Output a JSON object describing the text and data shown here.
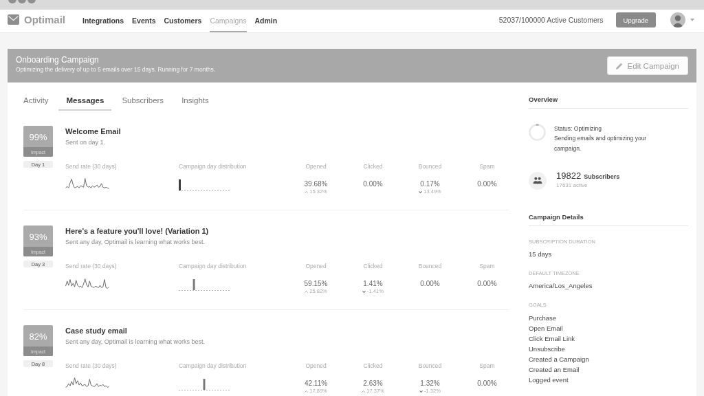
{
  "nav": {
    "logo": "Optimail",
    "links": [
      {
        "label": "Integrations",
        "selected": false
      },
      {
        "label": "Events",
        "selected": false
      },
      {
        "label": "Customers",
        "selected": false
      },
      {
        "label": "Campaigns",
        "selected": true
      },
      {
        "label": "Admin",
        "selected": false
      }
    ],
    "customer_count": "52037/100000 Active Customers",
    "upgrade_button": "Upgrade"
  },
  "campaign": {
    "title": "Onboarding Campaign",
    "subtitle": "Optimizing the delivery of up to 5 emails over 15 days. Running for 7 months.",
    "edit_button": "Edit Campaign"
  },
  "tabs": [
    {
      "label": "Activity",
      "selected": false
    },
    {
      "label": "Messages",
      "selected": true
    },
    {
      "label": "Subscribers",
      "selected": false
    },
    {
      "label": "Insights",
      "selected": false
    }
  ],
  "messages": [
    {
      "impact": "99%",
      "impact_label": "Impact",
      "day": "Day 1",
      "title": "Welcome Email",
      "subtitle": "Sent on day 1.",
      "send_rate_label": "Send rate (30 days)",
      "distribution_label": "Campaign day distribution",
      "metrics": [
        {
          "label": "Opened",
          "value": "39.68%",
          "delta": {
            "kind": "up",
            "text": "15.32%"
          }
        },
        {
          "label": "Clicked",
          "value": "0.00%"
        },
        {
          "label": "Bounced",
          "value": "0.17%",
          "delta": {
            "kind": "down",
            "text": "13.49%"
          }
        },
        {
          "label": "Spam",
          "value": "0.00%"
        }
      ]
    },
    {
      "impact": "93%",
      "impact_label": "Impact",
      "day": "Day 3",
      "title": "Here's a feature you'll love! (Variation 1)",
      "subtitle": "Sent any day, Optimail is learning what works best.",
      "send_rate_label": "Send rate (30 days)",
      "distribution_label": "Campaign day distribution",
      "metrics": [
        {
          "label": "Opened",
          "value": "59.15%",
          "delta": {
            "kind": "up",
            "text": "25.82%"
          }
        },
        {
          "label": "Clicked",
          "value": "1.41%",
          "delta": {
            "kind": "down",
            "text": "-1.41%"
          }
        },
        {
          "label": "Bounced",
          "value": "0.00%"
        },
        {
          "label": "Spam",
          "value": "0.00%"
        }
      ]
    },
    {
      "impact": "82%",
      "impact_label": "Impact",
      "day": "Day 8",
      "title": "Case study email",
      "subtitle": "Sent any day, Optimail is learning what works best.",
      "send_rate_label": "Send rate (30 days)",
      "distribution_label": "Campaign day distribution",
      "metrics": [
        {
          "label": "Opened",
          "value": "42.11%",
          "delta": {
            "kind": "up",
            "text": "17.89%"
          }
        },
        {
          "label": "Clicked",
          "value": "2.63%",
          "delta": {
            "kind": "up",
            "text": "17.37%"
          }
        },
        {
          "label": "Bounced",
          "value": "1.32%",
          "delta": {
            "kind": "down",
            "text": "-1.32%"
          }
        },
        {
          "label": "Spam",
          "value": "0.00%"
        }
      ]
    }
  ],
  "overview": {
    "heading": "Overview",
    "status_title": "Status: Optimizing",
    "status_text": "Sending emails and optimizing your campaign.",
    "subscribers_count": "19822",
    "subscribers_label": "Subscribers",
    "active_count": "17631 active"
  },
  "details": {
    "heading": "Campaign Details",
    "fields": [
      {
        "label": "SUBSCRIPTION DURATION",
        "value": "15 days"
      },
      {
        "label": "DEFAULT TIMEZONE",
        "value": "America/Los_Angeles"
      }
    ],
    "goals_label": "GOALS",
    "goals": [
      "Purchase",
      "Open Email",
      "Click Email Link",
      "Unsubscribe",
      "Created a Campaign",
      "Created an Email",
      "Logged event"
    ]
  }
}
